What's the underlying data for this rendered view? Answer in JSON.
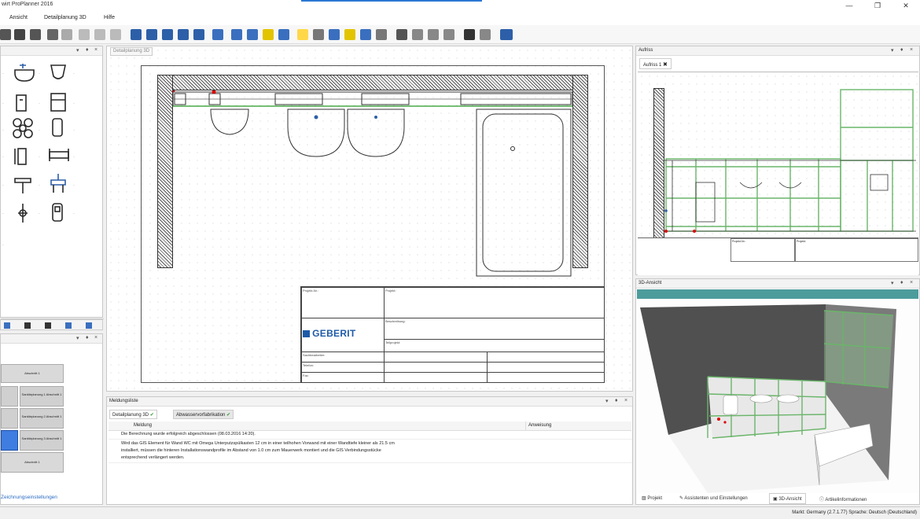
{
  "window": {
    "title": "wirt ProPlanner 2016"
  },
  "menu": {
    "items": [
      "Ansicht",
      "Detailplanung 3D",
      "Hilfe"
    ]
  },
  "tabs": {
    "main_tab": "Detailplanung 3D",
    "aufriss_panel": "Aufriss",
    "aufriss_tab": "Aufriss 1",
    "view3d_panel": "3D-Ansicht",
    "messages_panel": "Meldungsliste"
  },
  "title_block": {
    "logo": "GEBERIT",
    "projekt_nr": "Projekt-Nr.:",
    "projekt": "Projekt:",
    "beschreibung": "Beschreibung:",
    "teilprojekt": "Teilprojekt:",
    "sachbearbeiter": "Sachbearbeiter:",
    "telefon": "Telefon:",
    "fax": "Fax:"
  },
  "messages": {
    "tab_detail": "Detailplanung 3D",
    "tab_abwasser": "Abwasservorfabrikation",
    "col_meldung": "Meldung",
    "col_anweisung": "Anweisung",
    "rows": [
      "Die Berechnung wurde erfolgreich abgeschlossen (08.03.2016 14:20).",
      "Wird das GIS Element für Wand WC mit Omega Unterputzspülkasten 12 cm in einer teilhohen Vorwand mit einer Wandtiefe kleiner als 21.5 cm",
      "installiert, müssen die hinteren Installationswandprofile im Abstand von 1.0 cm zum Mauerwerk montiert und die GIS Verbindungsstücke",
      "entsprechend verlängert werden."
    ]
  },
  "left_lower": {
    "blocks": [
      "Abschnitt 1",
      "Sanitärplanung 1 Abschnitt 1",
      "Sanitärplanung 2 Abschnitt 1",
      "Sanitärplanung 3 Abschnitt 1",
      "Abschnitt 1"
    ],
    "link": "Zeichnungseinstellungen"
  },
  "bottom_tabs": [
    "Projekt",
    "Assistenten und Einstellungen",
    "3D-Ansicht",
    "Artikelinformationen"
  ],
  "status": "Markt: Germany (2.7.1.77) Sprache: Deutsch (Deutschland)",
  "colors": {
    "accent": "#2b78d4",
    "teal": "#4d9c9c",
    "green_frame": "#6ab56a"
  }
}
